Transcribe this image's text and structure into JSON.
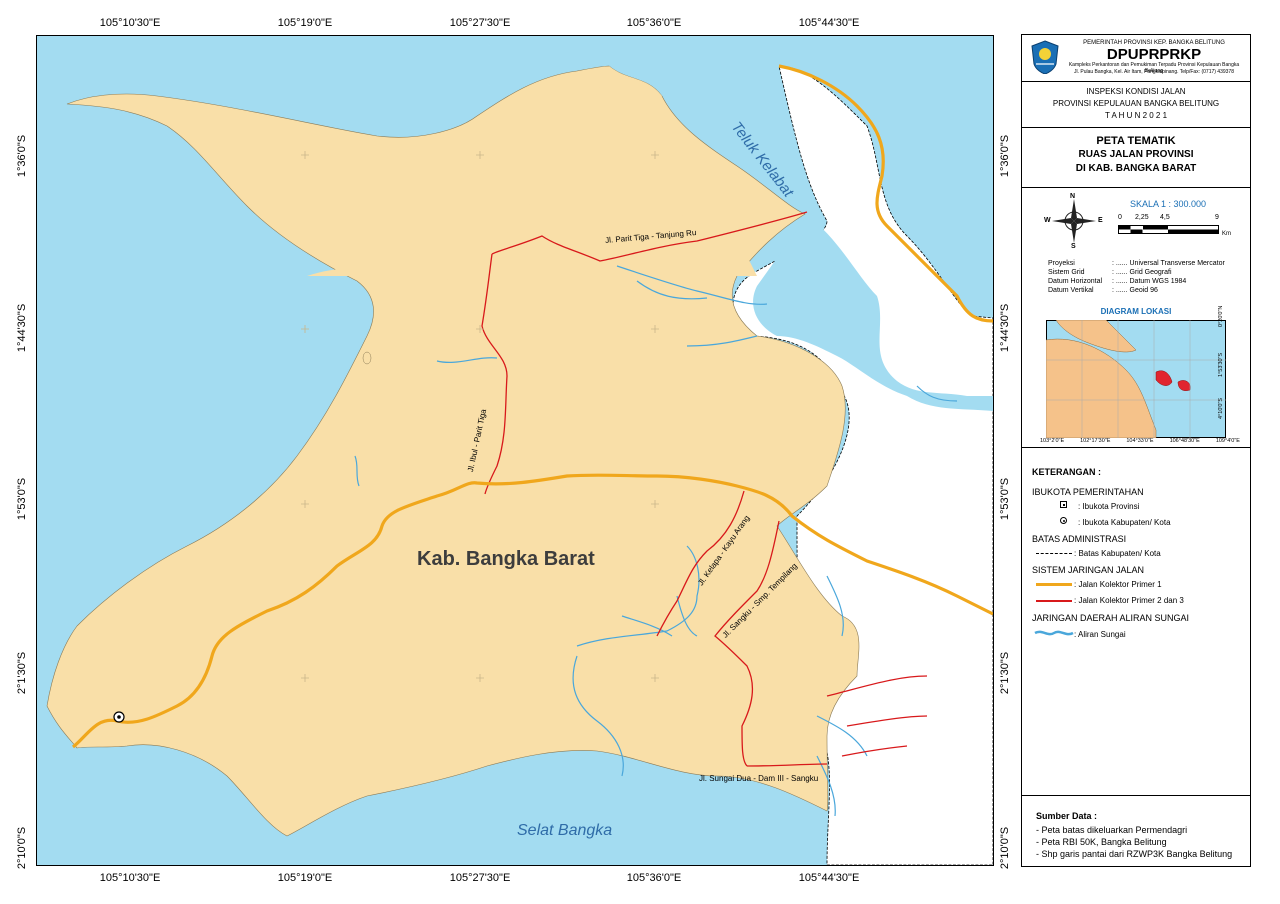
{
  "coords": {
    "top": [
      "105°10'30\"E",
      "105°19'0\"E",
      "105°27'30\"E",
      "105°36'0\"E",
      "105°44'30\"E"
    ],
    "bottom": [
      "105°10'30\"E",
      "105°19'0\"E",
      "105°27'30\"E",
      "105°36'0\"E",
      "105°44'30\"E"
    ],
    "left": [
      "1°36'0\"S",
      "1°44'30\"S",
      "1°53'0\"S",
      "2°1'30\"S",
      "2°10'0\"S"
    ],
    "right": [
      "1°36'0\"S",
      "1°44'30\"S",
      "1°53'0\"S",
      "2°1'30\"S",
      "2°10'0\"S"
    ]
  },
  "map": {
    "region_label": "Kab. Bangka Barat",
    "water_labels": {
      "bay": "Teluk Kelabat",
      "strait": "Selat Bangka"
    },
    "road_labels": {
      "parit_tiga_tanjung_ru": "Jl. Parit Tiga - Tanjung Ru",
      "ibul_parit_tiga": "Jl. Ibul - Parit Tiga",
      "kelapa_kayu_arang": "Jl. Kelapa - Kayu Arang",
      "sangku_tempilang": "Jl. Sangku - Smp. Tempilang",
      "sungai_dua_dam": "Jl. Sungai Dua - Dam III - Sangku"
    },
    "colors": {
      "sea": "#a3dcf1",
      "land": "#f9dfa8",
      "primary_road": "#f0a71c",
      "secondary_road": "#d8191b",
      "river": "#4aa7db"
    }
  },
  "header": {
    "agency_line": "PEMERINTAH PROVINSI KEP. BANGKA BELITUNG",
    "agency_name": "DPUPRPRKP",
    "agency_full": "Kampleks Perkantoran dan Pemukiman Terpadu Provinsi Kepulauan Bangka Belitung",
    "agency_address": "Jl. Pulau Bangka, Kel. Air Itam, Pangkalpinang. Telp/Fax: (0717) 439378"
  },
  "project": {
    "line1": "INSPEKSI KONDISI JALAN",
    "line2": "PROVINSI KEPULAUAN BANGKA BELITUNG",
    "line3": "T A H U N  2 0 2 1"
  },
  "title": {
    "line1": "PETA TEMATIK",
    "line2": "RUAS JALAN PROVINSI",
    "line3": "DI KAB. BANGKA BARAT"
  },
  "compass": {
    "n": "N",
    "s": "S",
    "e": "E",
    "w": "W"
  },
  "scale": {
    "label": "SKALA 1 : 300.000",
    "ticks": [
      "0",
      "2,25",
      "4,5",
      "9"
    ],
    "unit": "Km"
  },
  "projection": [
    {
      "key": "Proyeksi",
      "value": ": ...... Universal Transverse Mercator"
    },
    {
      "key": "Sistem Grid",
      "value": ": ...... Grid Geografi"
    },
    {
      "key": "Datum Horizontal",
      "value": ": ...... Datum WGS 1984"
    },
    {
      "key": "Datum Vertikal",
      "value": ": ...... Geoid 96"
    }
  ],
  "inset": {
    "title": "DIAGRAM LOKASI",
    "x_ticks": [
      "103°2'0\"E",
      "102°17'30\"E",
      "104°33'0\"E",
      "106°48'30\"E",
      "109°4'0\"E"
    ],
    "y_ticks": [
      "0°20'0\"N",
      "1°53'30\"S",
      "4°10'0\"S"
    ]
  },
  "legend": {
    "title": "KETERANGAN :",
    "gov_head": "IBUKOTA PEMERINTAHAN",
    "gov_items": [
      ": Ibukota Provinsi",
      ": Ibukota Kabupaten/ Kota"
    ],
    "admin_head": "BATAS ADMINISTRASI",
    "admin_item": ": Batas Kabupaten/ Kota",
    "road_head": "SISTEM JARINGAN JALAN",
    "road_items": [
      ": Jalan Kolektor Primer 1",
      ": Jalan Kolektor Primer 2 dan 3"
    ],
    "river_head": "JARINGAN DAERAH ALIRAN SUNGAI",
    "river_item": ": Aliran Sungai"
  },
  "sources": {
    "title": "Sumber Data :",
    "items": [
      "- Peta batas dikeluarkan Permendagri",
      "- Peta RBI 50K, Bangka Belitung",
      "- Shp garis pantai dari RZWP3K Bangka Belitung"
    ]
  }
}
